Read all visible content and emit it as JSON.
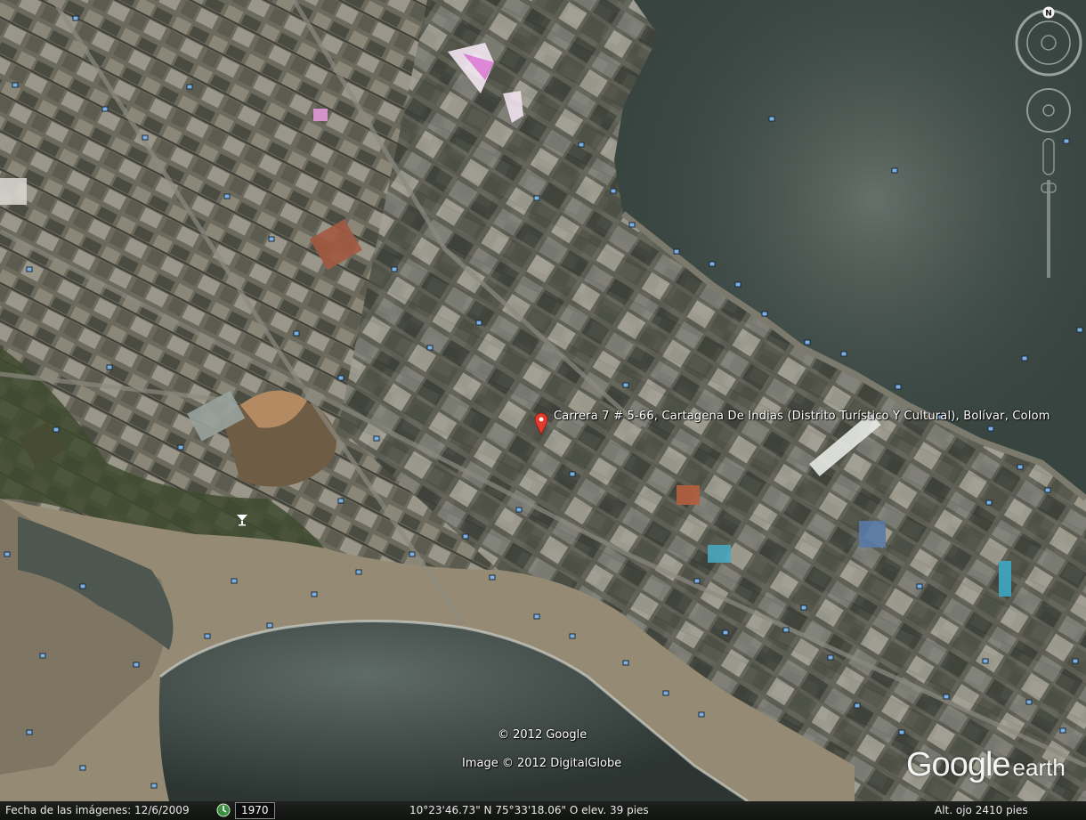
{
  "placemark": {
    "label": "Carrera 7 # 5-66, Cartagena De Indias (Distrito Turístico Y Cultural), Bolívar, Colom"
  },
  "attribution": {
    "copyright1": "© 2012 Google",
    "copyright2": "Image © 2012 DigitalGlobe"
  },
  "brand": {
    "google": "Google",
    "earth": "earth"
  },
  "compass": {
    "north": "N"
  },
  "status": {
    "imagery_date": "Fecha de las imágenes: 12/6/2009",
    "historical_year": "1970",
    "coordinates": "10°23'46.73\" N   75°33'18.06\" O  elev.   39 pies",
    "eye_alt": "Alt. ojo     2410 pies"
  },
  "icons": [
    "placemark-pin-icon",
    "photo-marker-icon",
    "cocktail-icon",
    "historical-imagery-icon",
    "compass-ring-icon",
    "look-joystick-icon",
    "move-joystick-icon",
    "zoom-slider-icon"
  ],
  "colors": {
    "sea": "#37443f",
    "shore": "#958a73",
    "city": "#6e6c5f",
    "pin": "#e33b2e",
    "marker": "#7bb1e6",
    "status_bg": "#151714"
  }
}
